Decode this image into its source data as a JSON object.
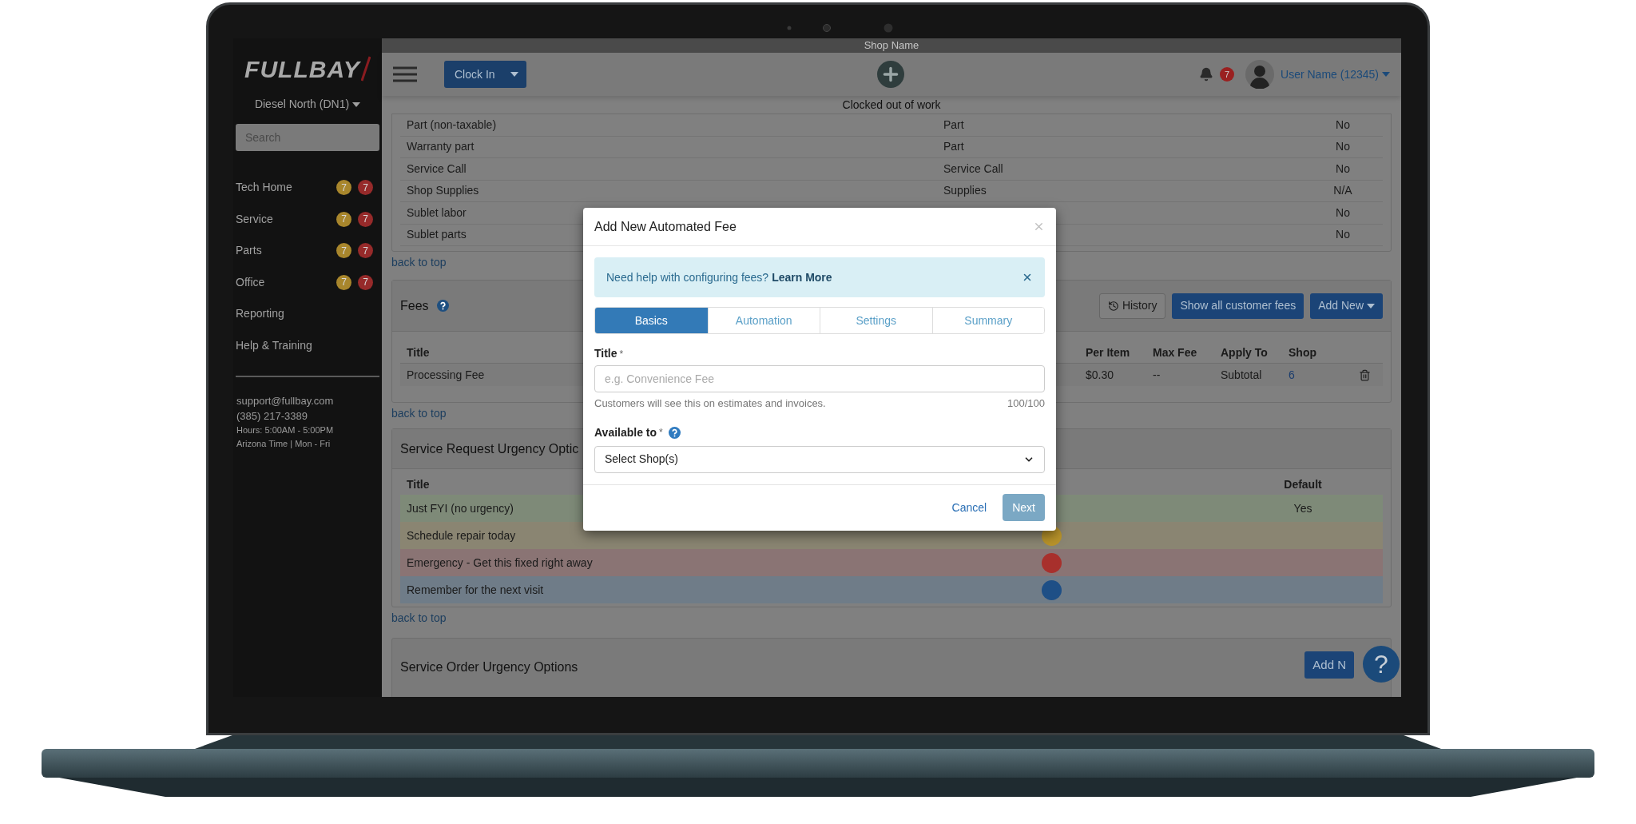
{
  "sidebar": {
    "logo": "FULLBAY",
    "store": "Diesel North (DN1)",
    "search": {
      "placeholder": "Search"
    },
    "nav": [
      {
        "label": "Tech Home",
        "badges": [
          {
            "text": "7",
            "color": "#a8862c"
          },
          {
            "text": "7",
            "color": "#962a2a"
          }
        ]
      },
      {
        "label": "Service",
        "badges": [
          {
            "text": "7",
            "color": "#a8862c"
          },
          {
            "text": "7",
            "color": "#962a2a"
          }
        ]
      },
      {
        "label": "Parts",
        "badges": [
          {
            "text": "7",
            "color": "#a8862c"
          },
          {
            "text": "7",
            "color": "#962a2a"
          }
        ]
      },
      {
        "label": "Office",
        "badges": [
          {
            "text": "7",
            "color": "#a8862c"
          },
          {
            "text": "7",
            "color": "#962a2a"
          }
        ]
      },
      {
        "label": "Reporting"
      },
      {
        "label": "Help & Training"
      }
    ],
    "contact": [
      {
        "text": "support@fullbay.com",
        "kind": "primary"
      },
      {
        "text": "(385) 217-3389",
        "kind": "primary"
      },
      {
        "text": "Hours: 5:00AM - 5:00PM",
        "kind": "detail"
      },
      {
        "text": "Arizona Time | Mon - Fri",
        "kind": "detail"
      }
    ]
  },
  "shop_bar": {
    "title": "Shop Name"
  },
  "topbar": {
    "clock_button": "Clock In",
    "status": "Clocked out of work",
    "notifications": "7",
    "user": "User Name (12345)"
  },
  "part_types": {
    "rows": [
      {
        "column_1": "Part (non-taxable)",
        "column_2": "Part",
        "column_3": "No"
      },
      {
        "column_1": "Warranty part",
        "column_2": "Part",
        "column_3": "No"
      },
      {
        "column_1": "Service Call",
        "column_2": "Service Call",
        "column_3": "No"
      },
      {
        "column_1": "Shop Supplies",
        "column_2": "Supplies",
        "column_3": "N/A"
      },
      {
        "column_1": "Sublet labor",
        "column_3": "No"
      },
      {
        "column_1": "Sublet parts",
        "column_3": "No"
      }
    ],
    "back_link": "back to top"
  },
  "fees": {
    "title": "Fees",
    "history_button": "History",
    "show_all_button": "Show all customer fees",
    "add_button": "Add New",
    "columns": {
      "title": "Title",
      "per_item": "Per Item",
      "max_fee": "Max Fee",
      "apply_to": "Apply To",
      "shop": "Shop"
    },
    "rows": [
      {
        "title": "Processing Fee",
        "per_item": "$0.30",
        "max_fee": "--",
        "apply_to": "Subtotal",
        "shop": "6"
      }
    ],
    "back_link": "back to top"
  },
  "urgency": {
    "title": "Service Request Urgency Optic",
    "columns": {
      "title": "Title",
      "default": "Default"
    },
    "rows": [
      {
        "title": "Just FYI (no urgency)",
        "default": "Yes",
        "color": "#7e8a78"
      },
      {
        "title": "Schedule repair today",
        "color": "#8a8572",
        "dot": {
          "color": "#b8932a"
        }
      },
      {
        "title": "Emergency - Get this fixed right away",
        "color": "#8a7474",
        "dot": {
          "color": "#a8302c"
        }
      },
      {
        "title": "Remember for the next visit",
        "color": "#6f7c88",
        "dot": {
          "color": "#1e4f86"
        }
      }
    ],
    "back_link": "back to top"
  },
  "order_urgency": {
    "title": "Service Order Urgency Options",
    "add_button": "Add N"
  },
  "help_button": "?",
  "modal": {
    "title": "Add New Automated Fee",
    "alert": {
      "text": "Need help with configuring fees?",
      "link": "Learn More"
    },
    "tabs": [
      {
        "label": "Basics",
        "selected": true
      },
      {
        "label": "Automation",
        "selected": false
      },
      {
        "label": "Settings",
        "selected": false
      },
      {
        "label": "Summary",
        "selected": false
      }
    ],
    "title_field": {
      "label": "Title",
      "required_mark": "*",
      "placeholder": "e.g. Convenience Fee",
      "hint": "Customers will see this on estimates and invoices.",
      "counter": "100/100"
    },
    "shop_field": {
      "label": "Available to",
      "required_mark": "*",
      "value": "Select Shop(s)"
    },
    "cancel": "Cancel",
    "next": {
      "label": "Next",
      "disabled": true
    }
  }
}
